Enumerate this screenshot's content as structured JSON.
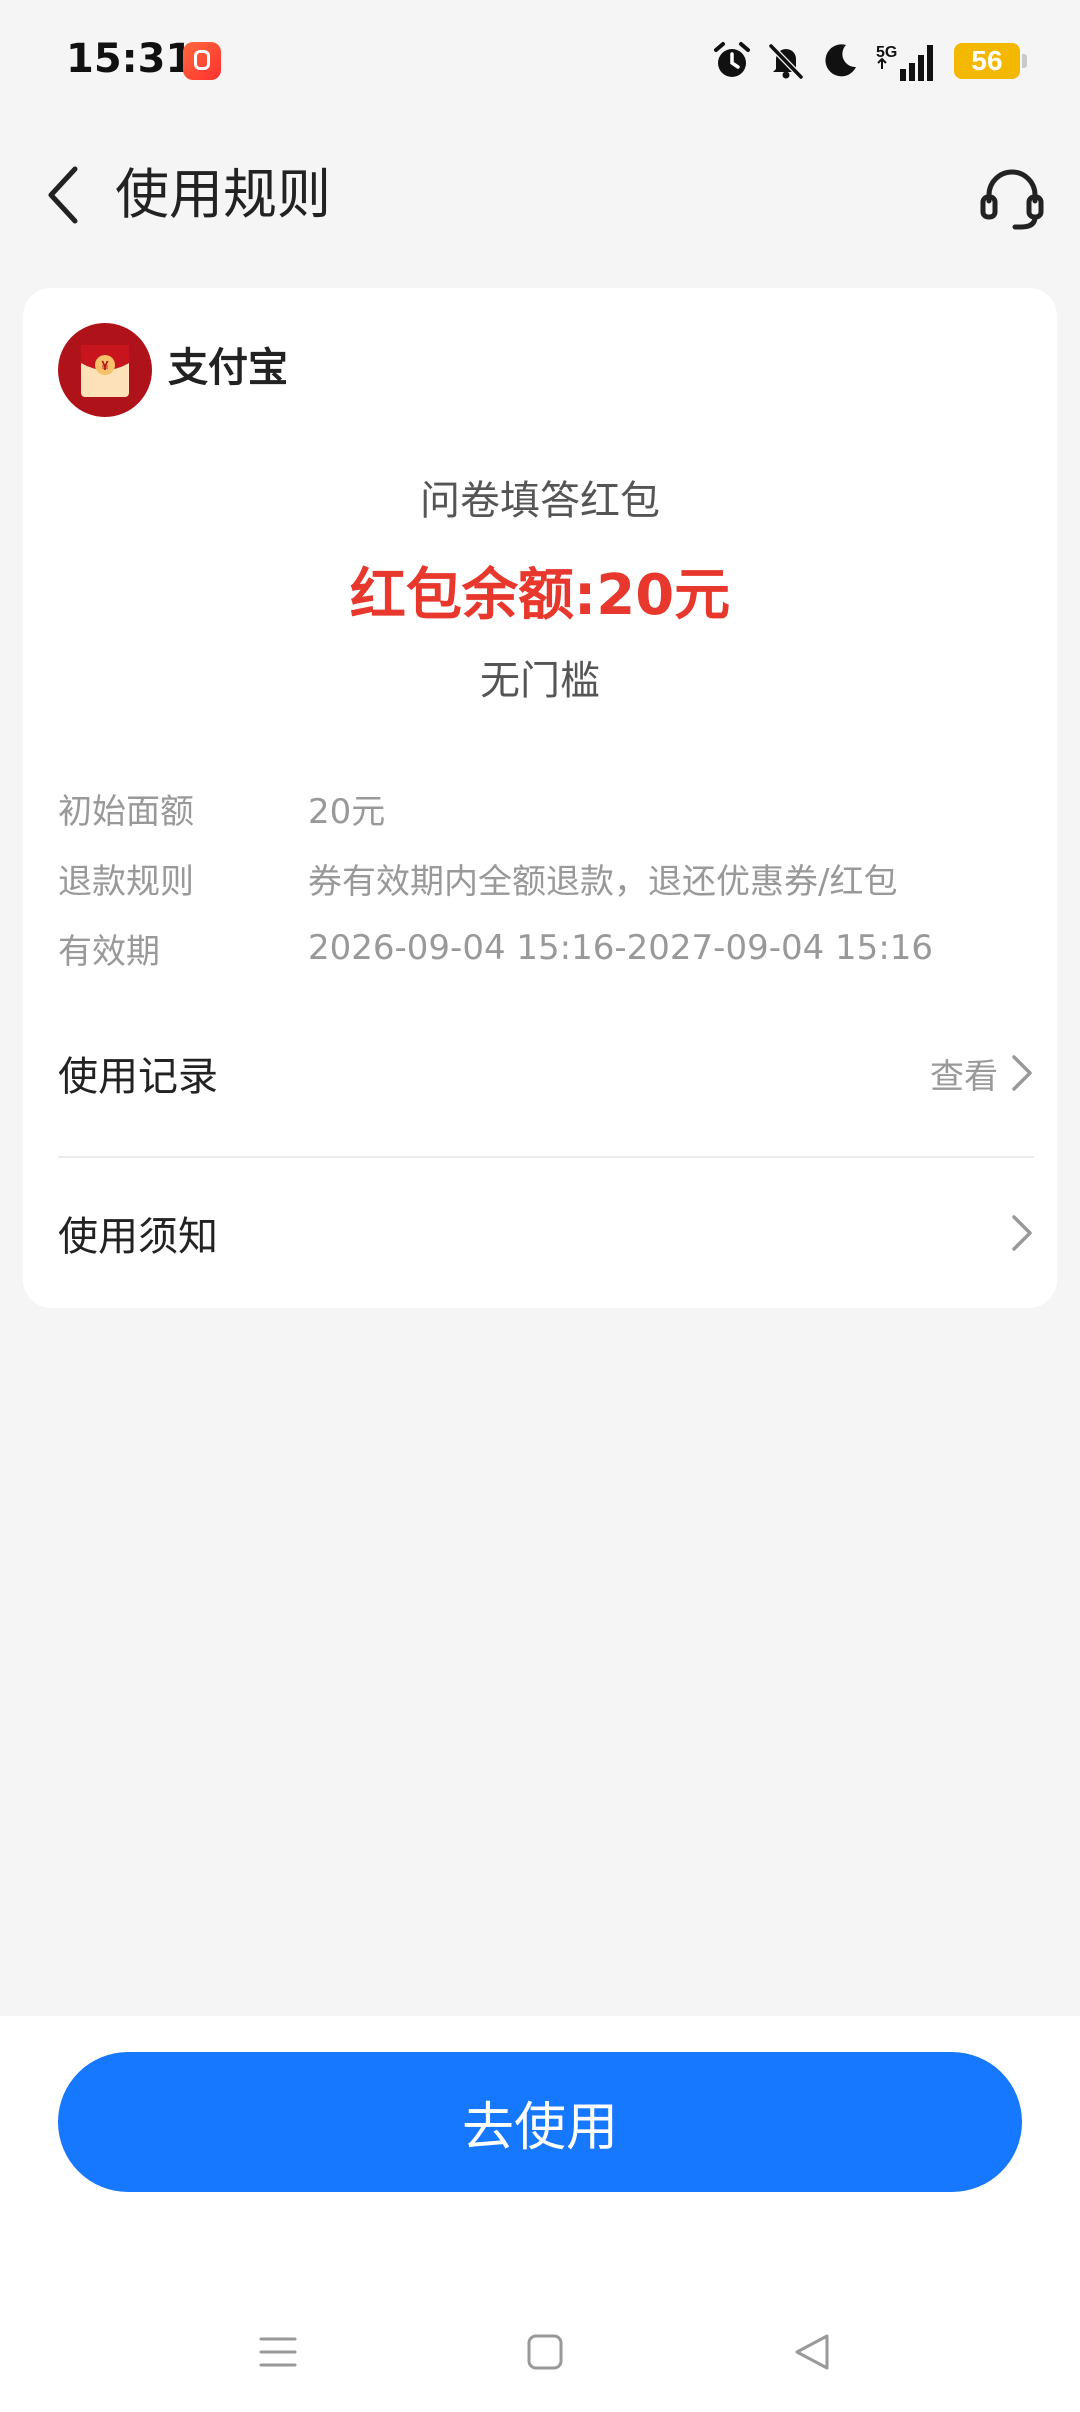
{
  "status_bar": {
    "time": "15:31",
    "network": "5G",
    "battery": "56",
    "icons": [
      "alarm-icon",
      "mute-icon",
      "moon-icon",
      "signal-icon"
    ]
  },
  "header": {
    "title": "使用规则",
    "back_icon": "chevron-left-icon",
    "support_icon": "headset-icon"
  },
  "card": {
    "merchant": "支付宝",
    "coupon_name": "问卷填答红包",
    "balance": "红包余额:20元",
    "threshold": "无门槛",
    "info": [
      {
        "label": "初始面额",
        "value": "20元"
      },
      {
        "label": "退款规则",
        "value": "券有效期内全额退款，退还优惠券/红包"
      },
      {
        "label": "有效期",
        "value": "2026-09-04 15:16-2027-09-04 15:16"
      }
    ],
    "menu": [
      {
        "label": "使用记录",
        "action": "查看"
      },
      {
        "label": "使用须知",
        "action": ""
      }
    ]
  },
  "bottom": {
    "use_button": "去使用"
  },
  "colors": {
    "accent": "#1677ff",
    "balance_red": "#e8372c",
    "background": "#f5f5f5"
  }
}
